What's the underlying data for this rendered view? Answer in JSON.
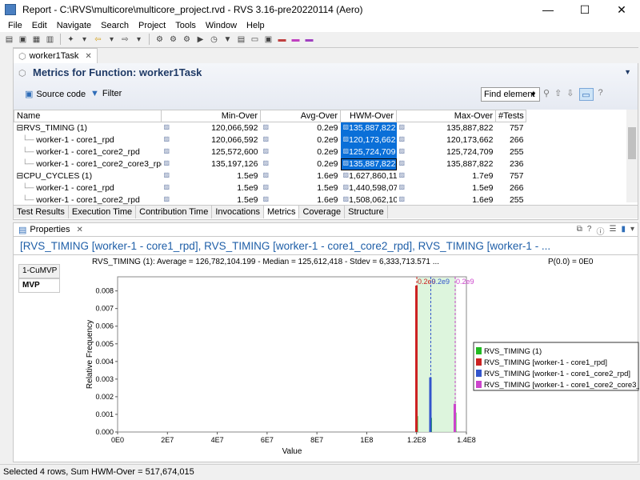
{
  "window": {
    "title": "Report - C:\\RVS\\multicore\\multicore_project.rvd - RVS 3.16-pre20220114 (Aero)",
    "minimize": "—",
    "maximize": "☐",
    "close": "✕"
  },
  "menu": [
    "File",
    "Edit",
    "Navigate",
    "Search",
    "Project",
    "Tools",
    "Window",
    "Help"
  ],
  "editor_tab": {
    "label": "worker1Task",
    "close": "✕"
  },
  "metrics": {
    "title": "Metrics for Function: worker1Task",
    "source_code_label": "Source code",
    "filter_label": "Filter",
    "find_element": "Find element",
    "columns": [
      "Name",
      "Min-Over",
      "Avg-Over",
      "HWM-Over",
      "Max-Over",
      "#Tests"
    ],
    "rows": [
      {
        "name": "RVS_TIMING (1)",
        "min": "120,066,592",
        "avg": "0.2e9",
        "hwm": "135,887,822",
        "max": "135,887,822",
        "tests": "757"
      },
      {
        "name": "worker-1 - core1_rpd",
        "min": "120,066,592",
        "avg": "0.2e9",
        "hwm": "120,173,662",
        "max": "120,173,662",
        "tests": "266"
      },
      {
        "name": "worker-1 - core1_core2_rpd",
        "min": "125,572,600",
        "avg": "0.2e9",
        "hwm": "125,724,709",
        "max": "125,724,709",
        "tests": "255"
      },
      {
        "name": "worker-1 - core1_core2_core3_rpd",
        "min": "135,197,126",
        "avg": "0.2e9",
        "hwm": "135,887,822",
        "max": "135,887,822",
        "tests": "236"
      },
      {
        "name": "CPU_CYCLES (1)",
        "min": "1.5e9",
        "avg": "1.6e9",
        "hwm": "1,627,860,117",
        "max": "1.7e9",
        "tests": "757"
      },
      {
        "name": "worker-1 - core1_rpd",
        "min": "1.5e9",
        "avg": "1.5e9",
        "hwm": "1,440,598,074",
        "max": "1.5e9",
        "tests": "266"
      },
      {
        "name": "worker-1 - core1_core2_rpd",
        "min": "1.5e9",
        "avg": "1.6e9",
        "hwm": "1,508,062,101",
        "max": "1.6e9",
        "tests": "255"
      }
    ],
    "bottom_tabs": [
      "Test Results",
      "Execution Time",
      "Contribution Time",
      "Invocations",
      "Metrics",
      "Coverage",
      "Structure"
    ],
    "active_bottom_tab": "Metrics"
  },
  "properties": {
    "tab_label": "Properties",
    "close": "✕",
    "title": "[RVS_TIMING [worker-1 - core1_rpd], RVS_TIMING [worker-1 - core1_core2_rpd], RVS_TIMING [worker-1 - ...",
    "stats": "RVS_TIMING (1): Average = 126,782,104.199 - Median = 125,612,418 - Stdev = 6,333,713.571 ...",
    "pvalue": "P(0.0) = 0E0",
    "side_tabs": [
      "1-CuMVP",
      "MVP"
    ],
    "active_side_tab": "MVP"
  },
  "chart_data": {
    "type": "bar",
    "xlabel": "Value",
    "ylabel": "Relative Frequency",
    "xlim": [
      0,
      140000000
    ],
    "ylim": [
      0,
      0.0088
    ],
    "x_ticks": [
      "0E0",
      "2E7",
      "4E7",
      "6E7",
      "8E7",
      "1E8",
      "1.2E8",
      "1.4E8"
    ],
    "y_ticks": [
      "0.000",
      "0.001",
      "0.002",
      "0.003",
      "0.004",
      "0.005",
      "0.006",
      "0.007",
      "0.008"
    ],
    "series": [
      {
        "name": "RVS_TIMING (1)",
        "color": "#22bb22",
        "x": [
          120100000,
          125700000,
          135500000
        ],
        "values": [
          0.0009,
          0.0008,
          0.0011
        ]
      },
      {
        "name": "RVS_TIMING [worker-1 - core1_rpd]",
        "color": "#cc2222",
        "x": [
          120100000
        ],
        "values": [
          0.0083
        ]
      },
      {
        "name": "RVS_TIMING [worker-1 - core1_core2_rpd]",
        "color": "#3355cc",
        "x": [
          125700000
        ],
        "values": [
          0.0031
        ]
      },
      {
        "name": "RVS_TIMING [worker-1 - core1_core2_core3_rpd]",
        "color": "#cc44cc",
        "x": [
          135500000
        ],
        "values": [
          0.0016
        ]
      }
    ],
    "markers": [
      {
        "label": "0.2e9",
        "x": 120100000,
        "color": "#cc2222"
      },
      {
        "label": "0.2e9",
        "x": 125700000,
        "color": "#3355cc"
      },
      {
        "label": "0.2e9",
        "x": 135500000,
        "color": "#cc44cc"
      }
    ],
    "shaded_range": [
      120100000,
      135900000
    ],
    "legend_position": "right"
  },
  "status": {
    "text": "Selected 4 rows, Sum HWM-Over = 517,674,015"
  }
}
